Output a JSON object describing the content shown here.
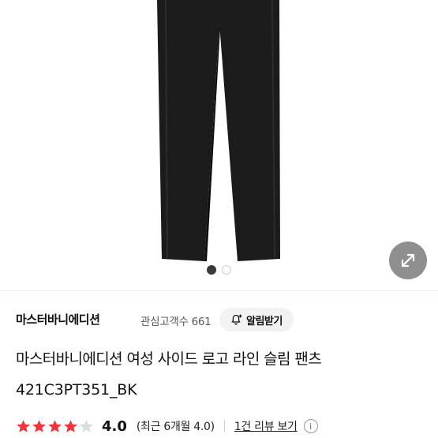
{
  "gallery": {
    "image_alt": "black slim pants",
    "slide_count": 2,
    "active_index": 0,
    "expand_icon": "expand-arrows-icon"
  },
  "product": {
    "brand": "마스터바니에디션",
    "interest_label": "관심고객수 661",
    "alarm_label": "알림받기",
    "alarm_icon": "bell-plus-icon",
    "title": "마스터바니에디션 여성 사이드 로고 라인 슬림 팬츠",
    "code": "421C3PT351_BK"
  },
  "rating": {
    "stars": 4.0,
    "value": "4.0",
    "period": "(최근 6개월 4.0)",
    "review_link": "1건 리뷰 보기",
    "info_icon": "info-icon",
    "star_color": "#f0353d"
  }
}
